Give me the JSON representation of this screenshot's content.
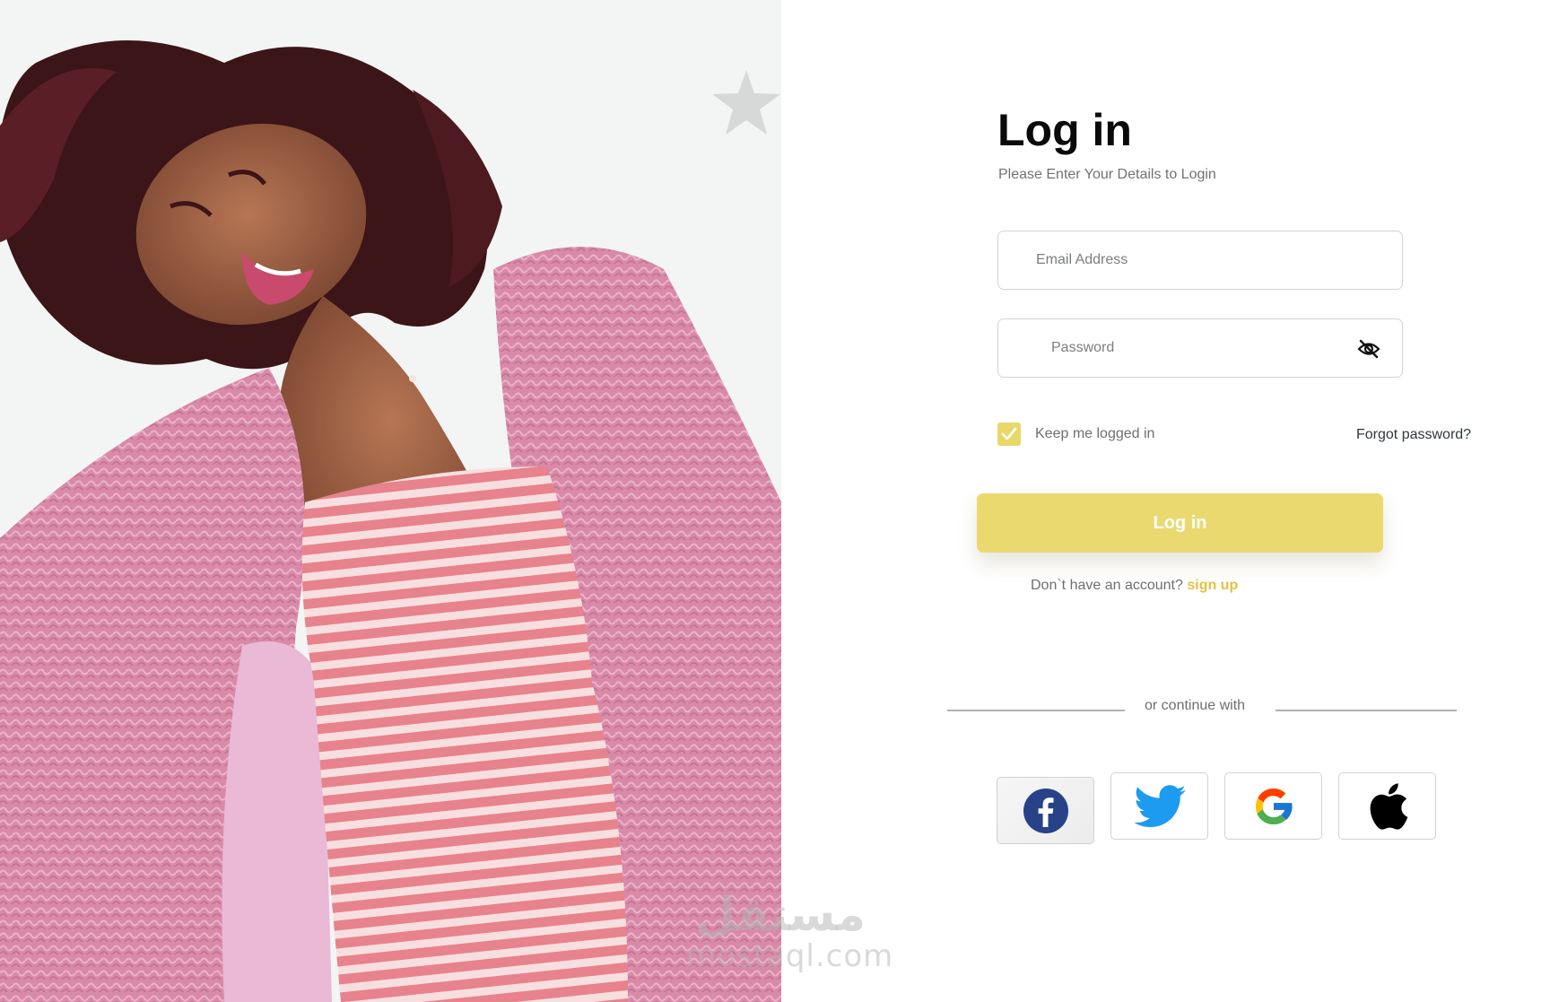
{
  "hero": {
    "image_alt": "Smiling woman with curly hair wearing a pink fluffy coat and striped dress"
  },
  "login": {
    "title": "Log in",
    "subtitle": "Please Enter Your Details to Login",
    "email_placeholder": "Email Address",
    "password_placeholder": "Password",
    "password_visibility_icon": "eye-off-icon",
    "keep_logged_in_label": "Keep me logged in",
    "keep_logged_in_checked": true,
    "forgot_password": "Forgot password?",
    "submit_label": "Log in",
    "signup_prompt": "Don`t have an account?",
    "signup_link": "sign up",
    "divider_text": "or continue with"
  },
  "social": [
    {
      "name": "Facebook",
      "icon": "facebook-icon"
    },
    {
      "name": "Twitter",
      "icon": "twitter-icon"
    },
    {
      "name": "Google",
      "icon": "google-icon"
    },
    {
      "name": "Apple",
      "icon": "apple-icon"
    }
  ],
  "watermark": {
    "arabic": "مستقل",
    "domain": "mostaql.com"
  },
  "colors": {
    "accent": "#ead96e",
    "link_accent": "#e0c342",
    "title": "#0a0a0a",
    "muted_text": "#6c6f71",
    "hero_background": "#f3f5f4"
  }
}
